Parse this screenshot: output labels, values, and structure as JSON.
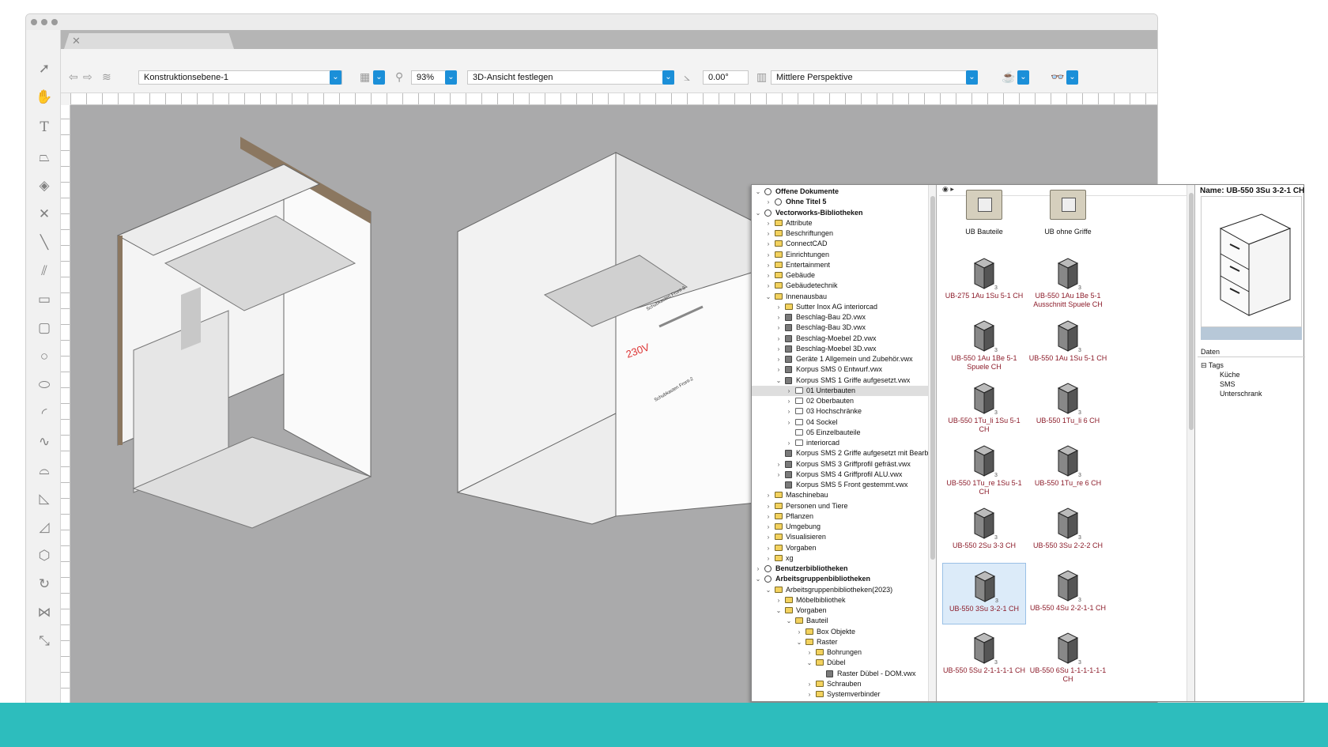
{
  "toolbar": {
    "layer": "Konstruktionsebene-1",
    "zoom": "93%",
    "view": "3D-Ansicht festlegen",
    "angle": "0.00°",
    "projection": "Mittlere Perspektive"
  },
  "canvas_labels": {
    "voltage": "230V",
    "drawer_note_1": "Schubkasten Front-3\nSMS K 124 / 18\nLichte Breite: 568",
    "drawer_note_2": "Schubkasten Front-2\nSMS K 232 / 18\nLichte Breite: 568\nNenn Lange 500\nBlum: 770N5002S\nLEGRABOX Zarge, Höhe F (241.0..."
  },
  "tree": [
    {
      "indent": 0,
      "chev": "v",
      "icon": "lib",
      "label": "Offene Dokumente",
      "bold": true
    },
    {
      "indent": 1,
      "chev": ">",
      "icon": "lib",
      "label": "Ohne Titel 5",
      "bold": true
    },
    {
      "indent": 0,
      "chev": "v",
      "icon": "lib",
      "label": "Vectorworks-Bibliotheken",
      "bold": true
    },
    {
      "indent": 1,
      "chev": ">",
      "icon": "folder",
      "label": "Attribute"
    },
    {
      "indent": 1,
      "chev": ">",
      "icon": "folder",
      "label": "Beschriftungen"
    },
    {
      "indent": 1,
      "chev": ">",
      "icon": "folder",
      "label": "ConnectCAD"
    },
    {
      "indent": 1,
      "chev": ">",
      "icon": "folder",
      "label": "Einrichtungen"
    },
    {
      "indent": 1,
      "chev": ">",
      "icon": "folder",
      "label": "Entertainment"
    },
    {
      "indent": 1,
      "chev": ">",
      "icon": "folder",
      "label": "Gebäude"
    },
    {
      "indent": 1,
      "chev": ">",
      "icon": "folder",
      "label": "Gebäudetechnik"
    },
    {
      "indent": 1,
      "chev": "v",
      "icon": "folder",
      "label": "Innenausbau"
    },
    {
      "indent": 2,
      "chev": ">",
      "icon": "folder",
      "label": "Sutter Inox AG interiorcad"
    },
    {
      "indent": 2,
      "chev": ">",
      "icon": "file",
      "label": "Beschlag-Bau 2D.vwx"
    },
    {
      "indent": 2,
      "chev": ">",
      "icon": "file",
      "label": "Beschlag-Bau 3D.vwx"
    },
    {
      "indent": 2,
      "chev": ">",
      "icon": "file",
      "label": "Beschlag-Moebel 2D.vwx"
    },
    {
      "indent": 2,
      "chev": ">",
      "icon": "file",
      "label": "Beschlag-Moebel 3D.vwx"
    },
    {
      "indent": 2,
      "chev": ">",
      "icon": "file",
      "label": "Geräte 1 Allgemein und Zubehör.vwx"
    },
    {
      "indent": 2,
      "chev": ">",
      "icon": "file",
      "label": "Korpus SMS 0 Entwurf.vwx"
    },
    {
      "indent": 2,
      "chev": "v",
      "icon": "file",
      "label": "Korpus SMS 1 Griffe aufgesetzt.vwx"
    },
    {
      "indent": 3,
      "chev": ">",
      "icon": "folder-w",
      "label": "01 Unterbauten",
      "sel": true
    },
    {
      "indent": 3,
      "chev": ">",
      "icon": "folder-w",
      "label": "02 Oberbauten"
    },
    {
      "indent": 3,
      "chev": ">",
      "icon": "folder-w",
      "label": "03 Hochschränke"
    },
    {
      "indent": 3,
      "chev": ">",
      "icon": "folder-w",
      "label": "04 Sockel"
    },
    {
      "indent": 3,
      "chev": "",
      "icon": "folder-w",
      "label": "05 Einzelbauteile"
    },
    {
      "indent": 3,
      "chev": ">",
      "icon": "folder-w",
      "label": "interiorcad"
    },
    {
      "indent": 2,
      "chev": "",
      "icon": "file",
      "label": "Korpus SMS 2 Griffe aufgesetzt mit Bearbe"
    },
    {
      "indent": 2,
      "chev": ">",
      "icon": "file",
      "label": "Korpus SMS 3 Griffprofil gefräst.vwx"
    },
    {
      "indent": 2,
      "chev": ">",
      "icon": "file",
      "label": "Korpus SMS 4 Griffprofil ALU.vwx"
    },
    {
      "indent": 2,
      "chev": "",
      "icon": "file",
      "label": "Korpus SMS 5 Front gestemmt.vwx"
    },
    {
      "indent": 1,
      "chev": ">",
      "icon": "folder",
      "label": "Maschinebau"
    },
    {
      "indent": 1,
      "chev": ">",
      "icon": "folder",
      "label": "Personen und Tiere"
    },
    {
      "indent": 1,
      "chev": ">",
      "icon": "folder",
      "label": "Pflanzen"
    },
    {
      "indent": 1,
      "chev": ">",
      "icon": "folder",
      "label": "Umgebung"
    },
    {
      "indent": 1,
      "chev": ">",
      "icon": "folder",
      "label": "Visualisieren"
    },
    {
      "indent": 1,
      "chev": ">",
      "icon": "folder",
      "label": "Vorgaben"
    },
    {
      "indent": 1,
      "chev": ">",
      "icon": "folder",
      "label": "xg"
    },
    {
      "indent": 0,
      "chev": ">",
      "icon": "lib",
      "label": "Benutzerbibliotheken",
      "bold": true
    },
    {
      "indent": 0,
      "chev": "v",
      "icon": "lib",
      "label": "Arbeitsgruppenbibliotheken",
      "bold": true
    },
    {
      "indent": 1,
      "chev": "v",
      "icon": "folder",
      "label": "Arbeitsgruppenbibliotheken(2023)"
    },
    {
      "indent": 2,
      "chev": ">",
      "icon": "folder",
      "label": "Möbelbibliothek"
    },
    {
      "indent": 2,
      "chev": "v",
      "icon": "folder",
      "label": "Vorgaben"
    },
    {
      "indent": 3,
      "chev": "v",
      "icon": "folder",
      "label": "Bauteil"
    },
    {
      "indent": 4,
      "chev": ">",
      "icon": "folder",
      "label": "Box Objekte"
    },
    {
      "indent": 4,
      "chev": "v",
      "icon": "folder",
      "label": "Raster"
    },
    {
      "indent": 5,
      "chev": ">",
      "icon": "folder",
      "label": "Bohrungen"
    },
    {
      "indent": 5,
      "chev": "v",
      "icon": "folder",
      "label": "Dübel"
    },
    {
      "indent": 6,
      "chev": "",
      "icon": "file",
      "label": "Raster Dübel - DOM.vwx"
    },
    {
      "indent": 5,
      "chev": ">",
      "icon": "folder",
      "label": "Schrauben"
    },
    {
      "indent": 5,
      "chev": ">",
      "icon": "folder",
      "label": "Systemverbinder"
    }
  ],
  "grid": [
    {
      "label": "UB Bauteile",
      "type": "folder"
    },
    {
      "label": "UB ohne Griffe",
      "type": "folder"
    },
    {
      "label": "UB-275 1Au 1Su 5-1 CH",
      "type": "cab"
    },
    {
      "label": "UB-550 1Au 1Be 5-1 Ausschnitt Spuele CH",
      "type": "cab"
    },
    {
      "label": "UB-550 1Au 1Be 5-1 Spuele CH",
      "type": "cab"
    },
    {
      "label": "UB-550 1Au 1Su 5-1 CH",
      "type": "cab"
    },
    {
      "label": "UB-550 1Tu_li 1Su 5-1 CH",
      "type": "cab"
    },
    {
      "label": "UB-550 1Tu_li 6 CH",
      "type": "cab"
    },
    {
      "label": "UB-550 1Tu_re 1Su 5-1 CH",
      "type": "cab"
    },
    {
      "label": "UB-550 1Tu_re 6 CH",
      "type": "cab"
    },
    {
      "label": "UB-550 2Su 3-3 CH",
      "type": "cab"
    },
    {
      "label": "UB-550 3Su 2-2-2 CH",
      "type": "cab"
    },
    {
      "label": "UB-550 3Su 3-2-1 CH",
      "type": "cab",
      "sel": true
    },
    {
      "label": "UB-550 4Su 2-2-1-1 CH",
      "type": "cab"
    },
    {
      "label": "UB-550 5Su 2-1-1-1-1 CH",
      "type": "cab"
    },
    {
      "label": "UB-550 6Su 1-1-1-1-1-1 CH",
      "type": "cab"
    }
  ],
  "badge": "3",
  "preview": {
    "name": "Name: UB-550 3Su 3-2-1 CH",
    "data_header": "Daten",
    "tags_label": "Tags",
    "tags": [
      "Küche",
      "SMS",
      "Unterschrank"
    ]
  },
  "colors": {
    "accent": "#1b8fd8",
    "footer": "#2dbdbd",
    "item_text": "#8c1c2a"
  }
}
